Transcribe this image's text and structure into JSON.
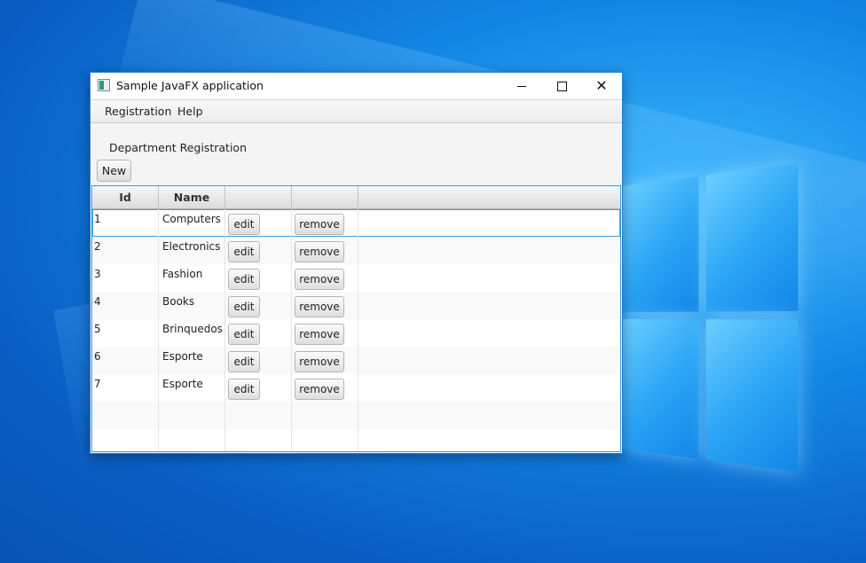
{
  "window": {
    "title": "Sample JavaFX application",
    "controls": {
      "minimize": "minimize",
      "maximize": "maximize",
      "close": "✕"
    }
  },
  "menubar": {
    "items": [
      "Registration",
      "Help"
    ]
  },
  "panel": {
    "title": "Department Registration",
    "new_button": "New"
  },
  "table": {
    "columns": [
      "Id",
      "Name",
      "",
      ""
    ],
    "edit_label": "edit",
    "remove_label": "remove",
    "rows": [
      {
        "id": "1",
        "name": "Computers"
      },
      {
        "id": "2",
        "name": "Electronics"
      },
      {
        "id": "3",
        "name": "Fashion"
      },
      {
        "id": "4",
        "name": "Books"
      },
      {
        "id": "5",
        "name": "Brinquedos"
      },
      {
        "id": "6",
        "name": "Esporte"
      },
      {
        "id": "7",
        "name": "Esporte"
      }
    ],
    "selected_row": 0
  },
  "colors": {
    "accent": "#3d9cd8",
    "desktop": "#0a6fd0"
  },
  "icons": {
    "app": "javafx-app-icon",
    "windows_logo": "windows-logo-icon"
  }
}
